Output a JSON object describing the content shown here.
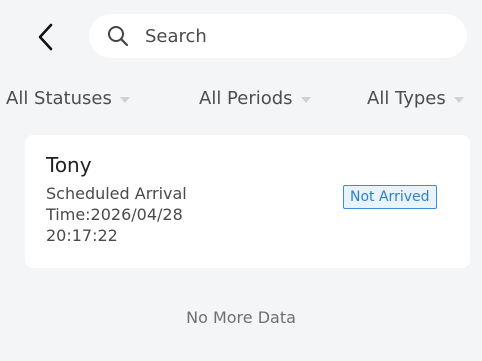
{
  "search": {
    "placeholder": "Search"
  },
  "filters": [
    {
      "label": "All Statuses"
    },
    {
      "label": "All Periods"
    },
    {
      "label": "All Types"
    }
  ],
  "records": [
    {
      "name": "Tony",
      "scheduled_arrival": "Scheduled Arrival Time:2026/04/28 20:17:22",
      "status": "Not Arrived",
      "status_color": "#2d7fcf"
    }
  ],
  "footer": {
    "no_more": "No More Data"
  },
  "icons": {
    "back": "chevron-left-icon",
    "search": "search-icon",
    "dropdown": "caret-down-icon"
  }
}
